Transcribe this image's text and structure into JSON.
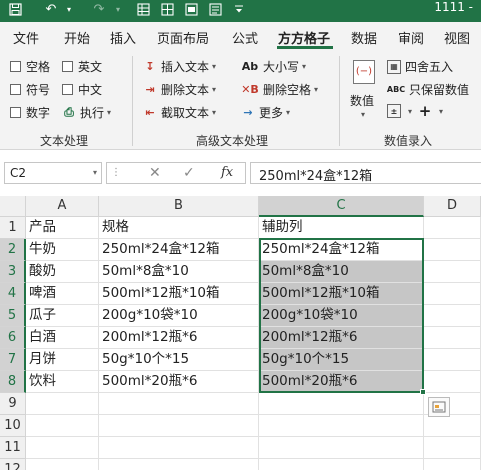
{
  "titlebar": {
    "title": "1111 -"
  },
  "tabs": [
    "文件",
    "开始",
    "插入",
    "页面布局",
    "公式",
    "方方格子",
    "数据",
    "审阅",
    "视图"
  ],
  "ribbon": {
    "checkboxes": [
      "空格",
      "英文",
      "符号",
      "中文",
      "数字",
      "执行"
    ],
    "text_commands": [
      "插入文本",
      "删除文本",
      "截取文本",
      "大小写",
      "删除空格",
      "更多"
    ],
    "numeric": {
      "value_label": "数值",
      "round": "四舍五入",
      "keep_values": "只保留数值"
    },
    "groups": [
      "文本处理",
      "高级文本处理",
      "数值录入"
    ]
  },
  "formula_bar": {
    "name_box": "C2",
    "fx_symbol": "fx",
    "value": "250ml*24盒*12箱"
  },
  "grid": {
    "columns": [
      "A",
      "B",
      "C",
      "D"
    ],
    "rows": [
      "1",
      "2",
      "3",
      "4",
      "5",
      "6",
      "7",
      "8",
      "9",
      "10",
      "11",
      "12"
    ],
    "data": [
      [
        "产品",
        "规格",
        "辅助列"
      ],
      [
        "牛奶",
        "250ml*24盒*12箱",
        "250ml*24盒*12箱"
      ],
      [
        "酸奶",
        "50ml*8盒*10",
        "50ml*8盒*10"
      ],
      [
        "啤酒",
        "500ml*12瓶*10箱",
        "500ml*12瓶*10箱"
      ],
      [
        "瓜子",
        "200g*10袋*10",
        "200g*10袋*10"
      ],
      [
        "白酒",
        "200ml*12瓶*6",
        "200ml*12瓶*6"
      ],
      [
        "月饼",
        "50g*10个*15",
        "50g*10个*15"
      ],
      [
        "饮料",
        "500ml*20瓶*6",
        "500ml*20瓶*6"
      ]
    ]
  }
}
